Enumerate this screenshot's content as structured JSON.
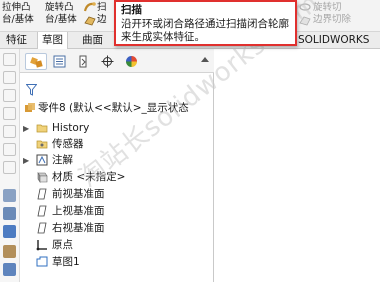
{
  "ribbon": {
    "extrude_boss": "拉伸凸",
    "extrude_boss_2": "台/基体",
    "revolve_boss": "旋转凸",
    "revolve_boss_2": "台/基体",
    "sweep_partial": "扫",
    "boundary_partial": "边",
    "revolve_cut": "旋转切",
    "boundary_cut": "边界切除"
  },
  "tabs": [
    "特征",
    "草图",
    "曲面",
    "SOLIDWORKS 插件"
  ],
  "tooltip": {
    "title": "扫描",
    "body": "沿开环或闭合路径通过扫描闭合轮廓来生成实体特征。"
  },
  "tree": {
    "root": "零件8 (默认<<默认>_显示状态",
    "items": [
      "History",
      "传感器",
      "注解",
      "材质 <未指定>",
      "前视基准面",
      "上视基准面",
      "右视基准面",
      "原点",
      "草图1"
    ]
  },
  "watermark": "淘站长solidworks.com",
  "colors": {
    "tooltip_border": "#e0302e",
    "accent": "#1f5fbf"
  }
}
